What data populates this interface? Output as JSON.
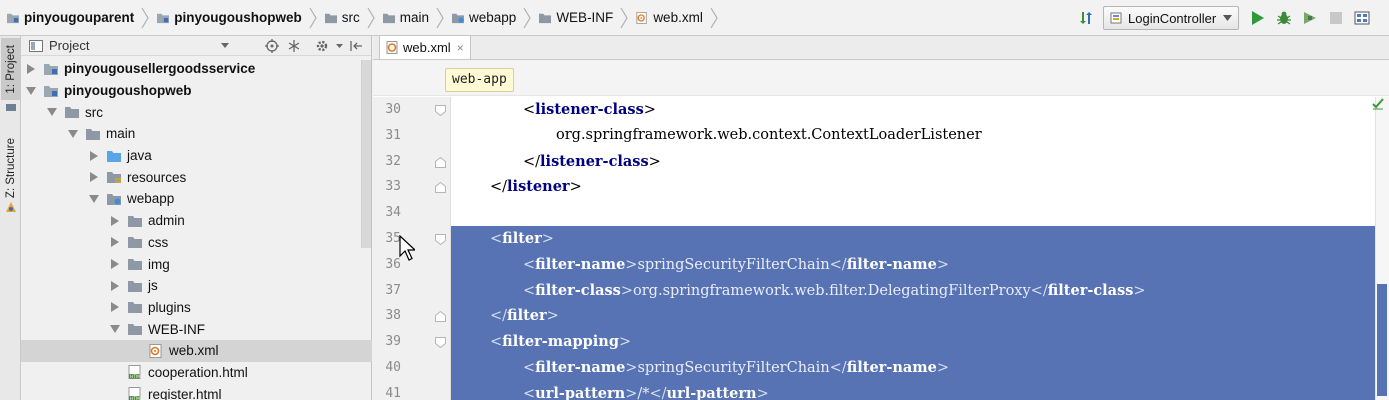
{
  "navbar": {
    "breadcrumbs": [
      {
        "label": "pinyougouparent",
        "bold": true,
        "icon": "module-folder-icon"
      },
      {
        "label": "pinyougoushopweb",
        "bold": true,
        "icon": "module-folder-icon"
      },
      {
        "label": "src",
        "bold": false,
        "icon": "folder-icon"
      },
      {
        "label": "main",
        "bold": false,
        "icon": "folder-icon"
      },
      {
        "label": "webapp",
        "bold": false,
        "icon": "web-folder-icon"
      },
      {
        "label": "WEB-INF",
        "bold": false,
        "icon": "folder-icon"
      },
      {
        "label": "web.xml",
        "bold": false,
        "icon": "xml-file-icon"
      }
    ],
    "run_config": "LoginController"
  },
  "side_tabs": {
    "project": "1: Project",
    "structure": "Z: Structure"
  },
  "project_panel": {
    "title": "Project",
    "tree": [
      {
        "label": "pinyougousellergoodsservice",
        "depth": 0,
        "arrow": "right",
        "icon": "module-folder-icon",
        "bold": true
      },
      {
        "label": "pinyougoushopweb",
        "depth": 0,
        "arrow": "down",
        "icon": "module-folder-icon",
        "bold": true
      },
      {
        "label": "src",
        "depth": 1,
        "arrow": "down",
        "icon": "folder-icon",
        "bold": false
      },
      {
        "label": "main",
        "depth": 2,
        "arrow": "down",
        "icon": "folder-icon",
        "bold": false
      },
      {
        "label": "java",
        "depth": 3,
        "arrow": "right",
        "icon": "source-folder-icon",
        "bold": false
      },
      {
        "label": "resources",
        "depth": 3,
        "arrow": "right",
        "icon": "resources-folder-icon",
        "bold": false
      },
      {
        "label": "webapp",
        "depth": 3,
        "arrow": "down",
        "icon": "web-folder-icon",
        "bold": false
      },
      {
        "label": "admin",
        "depth": 4,
        "arrow": "right",
        "icon": "folder-icon",
        "bold": false
      },
      {
        "label": "css",
        "depth": 4,
        "arrow": "right",
        "icon": "folder-icon",
        "bold": false
      },
      {
        "label": "img",
        "depth": 4,
        "arrow": "right",
        "icon": "folder-icon",
        "bold": false
      },
      {
        "label": "js",
        "depth": 4,
        "arrow": "right",
        "icon": "folder-icon",
        "bold": false
      },
      {
        "label": "plugins",
        "depth": 4,
        "arrow": "right",
        "icon": "folder-icon",
        "bold": false
      },
      {
        "label": "WEB-INF",
        "depth": 4,
        "arrow": "down",
        "icon": "folder-icon",
        "bold": false
      },
      {
        "label": "web.xml",
        "depth": 5,
        "arrow": "none",
        "icon": "xml-file-icon",
        "bold": false,
        "selected": true
      },
      {
        "label": "cooperation.html",
        "depth": 4,
        "arrow": "none",
        "icon": "html-file-icon",
        "bold": false
      },
      {
        "label": "register.html",
        "depth": 4,
        "arrow": "none",
        "icon": "html-file-icon",
        "bold": false
      }
    ]
  },
  "editor": {
    "tab": {
      "label": "web.xml",
      "close": "×"
    },
    "tag_breadcrumb": "web-app",
    "selection_color": "#5873b3",
    "lines": [
      {
        "num": "30",
        "indent": 2,
        "parts": [
          [
            "brk",
            "<"
          ],
          [
            "tag",
            "listener-class"
          ],
          [
            "brk",
            ">"
          ]
        ],
        "fold": "start",
        "selected": false
      },
      {
        "num": "31",
        "indent": 3,
        "parts": [
          [
            "txt",
            "org.springframework.web.context.ContextLoaderListener"
          ]
        ],
        "fold": "none",
        "selected": false
      },
      {
        "num": "32",
        "indent": 2,
        "parts": [
          [
            "brk",
            "</"
          ],
          [
            "tag",
            "listener-class"
          ],
          [
            "brk",
            ">"
          ]
        ],
        "fold": "end",
        "selected": false
      },
      {
        "num": "33",
        "indent": 1,
        "parts": [
          [
            "brk",
            "</"
          ],
          [
            "tag",
            "listener"
          ],
          [
            "brk",
            ">"
          ]
        ],
        "fold": "end",
        "selected": false
      },
      {
        "num": "34",
        "indent": 0,
        "parts": [],
        "fold": "none",
        "selected": false
      },
      {
        "num": "35",
        "indent": 1,
        "parts": [
          [
            "brk",
            "<"
          ],
          [
            "tag",
            "filter"
          ],
          [
            "brk",
            ">"
          ]
        ],
        "fold": "start",
        "selected": true
      },
      {
        "num": "36",
        "indent": 2,
        "parts": [
          [
            "brk",
            "<"
          ],
          [
            "tag",
            "filter-name"
          ],
          [
            "brk",
            ">"
          ],
          [
            "txt",
            "springSecurityFilterChain"
          ],
          [
            "brk",
            "</"
          ],
          [
            "tag",
            "filter-name"
          ],
          [
            "brk",
            ">"
          ]
        ],
        "fold": "none",
        "selected": true
      },
      {
        "num": "37",
        "indent": 2,
        "parts": [
          [
            "brk",
            "<"
          ],
          [
            "tag",
            "filter-class"
          ],
          [
            "brk",
            ">"
          ],
          [
            "txt",
            "org.springframework.web.filter.DelegatingFilterProxy"
          ],
          [
            "brk",
            "</"
          ],
          [
            "tag",
            "filter-class"
          ],
          [
            "brk",
            ">"
          ]
        ],
        "fold": "none",
        "selected": true
      },
      {
        "num": "38",
        "indent": 1,
        "parts": [
          [
            "brk",
            "</"
          ],
          [
            "tag",
            "filter"
          ],
          [
            "brk",
            ">"
          ]
        ],
        "fold": "end",
        "selected": true
      },
      {
        "num": "39",
        "indent": 1,
        "parts": [
          [
            "brk",
            "<"
          ],
          [
            "tag",
            "filter-mapping"
          ],
          [
            "brk",
            ">"
          ]
        ],
        "fold": "start",
        "selected": true
      },
      {
        "num": "40",
        "indent": 2,
        "parts": [
          [
            "brk",
            "<"
          ],
          [
            "tag",
            "filter-name"
          ],
          [
            "brk",
            ">"
          ],
          [
            "txt",
            "springSecurityFilterChain"
          ],
          [
            "brk",
            "</"
          ],
          [
            "tag",
            "filter-name"
          ],
          [
            "brk",
            ">"
          ]
        ],
        "fold": "none",
        "selected": true
      },
      {
        "num": "41",
        "indent": 2,
        "parts": [
          [
            "brk",
            "<"
          ],
          [
            "tag",
            "url-pattern"
          ],
          [
            "brk",
            ">"
          ],
          [
            "txt",
            "/*"
          ],
          [
            "brk",
            "</"
          ],
          [
            "tag",
            "url-pattern"
          ],
          [
            "brk",
            ">"
          ]
        ],
        "fold": "none",
        "selected": true
      }
    ]
  }
}
